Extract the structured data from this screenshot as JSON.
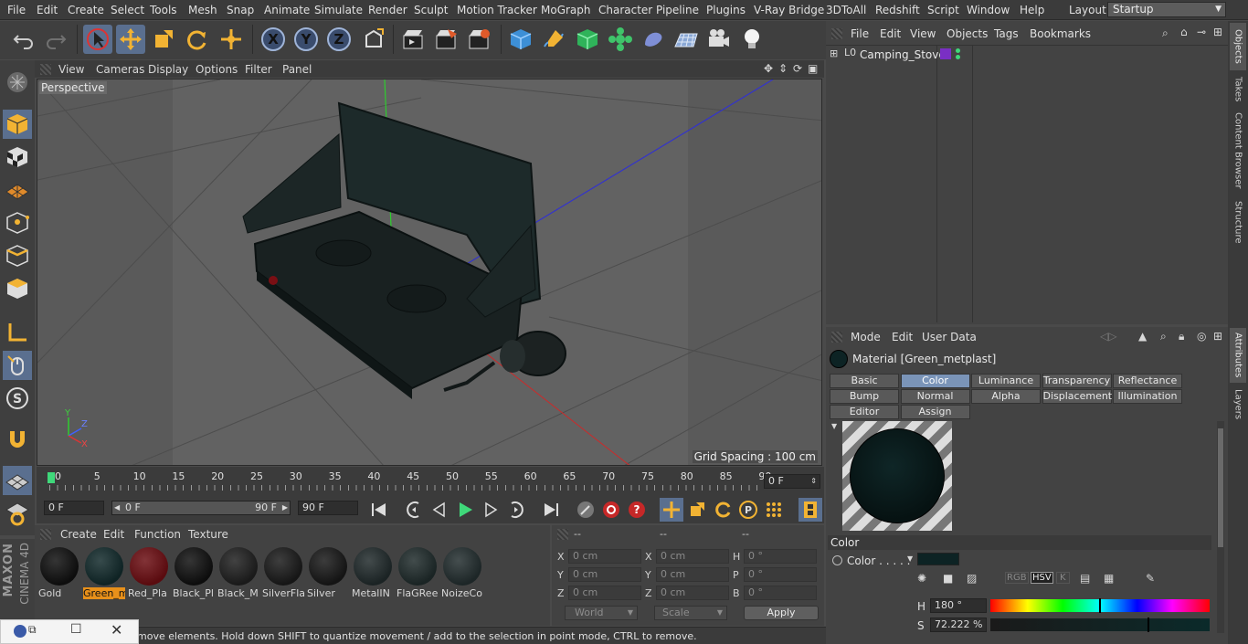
{
  "menubar": {
    "items": [
      "File",
      "Edit",
      "Create",
      "Select",
      "Tools",
      "Mesh",
      "Snap",
      "Animate",
      "Simulate",
      "Render",
      "Sculpt",
      "Motion Tracker",
      "MoGraph",
      "Character",
      "Pipeline",
      "Plugins",
      "V-Ray Bridge",
      "3DToAll",
      "Redshift",
      "Script",
      "Window",
      "Help"
    ],
    "layout_label": "Layout:",
    "layout_value": "Startup"
  },
  "viewport": {
    "menu": [
      "View",
      "Cameras",
      "Display",
      "Options",
      "Filter",
      "Panel"
    ],
    "label": "Perspective",
    "grid_spacing": "Grid Spacing : 100 cm",
    "axis_labels": {
      "y": "Y",
      "z": "Z",
      "x": "X"
    }
  },
  "timeline": {
    "ticks": [
      "0",
      "5",
      "10",
      "15",
      "20",
      "25",
      "30",
      "35",
      "40",
      "45",
      "50",
      "55",
      "60",
      "65",
      "70",
      "75",
      "80",
      "85",
      "90"
    ],
    "current_frame": "0 F",
    "start_field": "0 F",
    "range_start": "0 F",
    "range_end": "90 F",
    "end_field": "90 F"
  },
  "material_manager": {
    "menu": [
      "Create",
      "Edit",
      "Function",
      "Texture"
    ],
    "materials": [
      {
        "name": "Gold",
        "color": "#0d0d0d"
      },
      {
        "name": "Green_m",
        "color": "#0f2324",
        "selected": true
      },
      {
        "name": "Red_Pla",
        "color": "#5a0b0f"
      },
      {
        "name": "Black_Pl",
        "color": "#0d0d0d"
      },
      {
        "name": "Black_M",
        "color": "#1a1a1a"
      },
      {
        "name": "SilverFla",
        "color": "#161616"
      },
      {
        "name": "Silver",
        "color": "#141414"
      },
      {
        "name": "MetalIN",
        "color": "#1b2324"
      },
      {
        "name": "FlaGRee",
        "color": "#1a2424"
      },
      {
        "name": "NoizeCo",
        "color": "#1d2627"
      }
    ]
  },
  "coordinates": {
    "headers": [
      "--",
      "--",
      "--"
    ],
    "rows": [
      {
        "a": "X",
        "av": "0 cm",
        "b": "X",
        "bv": "0 cm",
        "c": "H",
        "cv": "0 °"
      },
      {
        "a": "Y",
        "av": "0 cm",
        "b": "Y",
        "bv": "0 cm",
        "c": "P",
        "cv": "0 °"
      },
      {
        "a": "Z",
        "av": "0 cm",
        "b": "Z",
        "bv": "0 cm",
        "c": "B",
        "cv": "0 °"
      }
    ],
    "mode_select": "World",
    "scale_select": "Scale",
    "apply": "Apply"
  },
  "status": {
    "text": "move elements. Hold down SHIFT to quantize movement / add to the selection in point mode, CTRL to remove."
  },
  "object_manager": {
    "menu": [
      "File",
      "Edit",
      "View",
      "Objects",
      "Tags",
      "Bookmarks"
    ],
    "object_name": "Camping_Stove",
    "layer_label": "L0"
  },
  "attributes": {
    "menu": [
      "Mode",
      "Edit",
      "User Data"
    ],
    "title": "Material [Green_metplast]",
    "tabs_row1": [
      "Basic",
      "Color",
      "Luminance",
      "Transparency",
      "Reflectance"
    ],
    "tabs_row2": [
      "Bump",
      "Normal",
      "Alpha",
      "Displacement",
      "Illumination"
    ],
    "tabs_row3": [
      "Editor",
      "Assign"
    ],
    "active_tab": "Color",
    "section": "Color",
    "color_label": "Color . . . . .",
    "swatch": "#0d2324",
    "color_modes": [
      "RGB",
      "HSV",
      "K"
    ],
    "h_label": "H",
    "h_value": "180 °",
    "s_label": "S",
    "s_value": "72.222 %",
    "h_fraction": 0.5,
    "s_fraction": 0.72222
  },
  "right_tabs": [
    "Objects",
    "Takes",
    "Content Browser",
    "Structure",
    "Attributes",
    "Layers"
  ],
  "branding": {
    "maxon": "MAXON",
    "product": "CINEMA 4D"
  }
}
